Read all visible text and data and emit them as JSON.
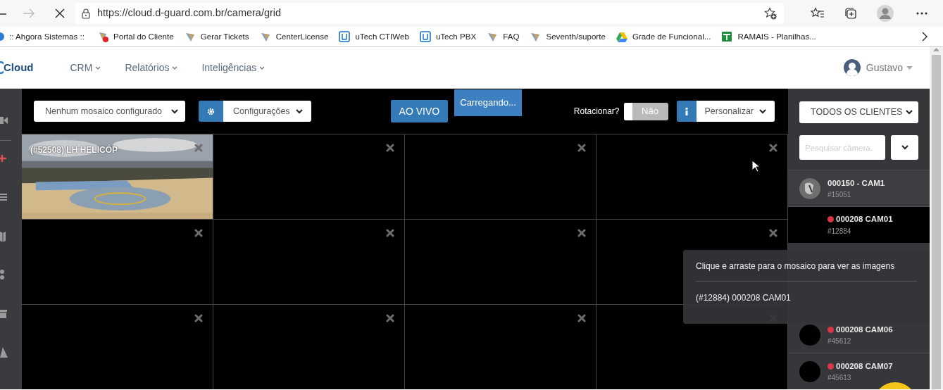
{
  "browser": {
    "url": "https://cloud.d-guard.com.br/camera/grid",
    "bookmarks": [
      {
        "label": ":: Ahgora Sistemas ::"
      },
      {
        "label": "Portal do Cliente"
      },
      {
        "label": "Gerar Tickets"
      },
      {
        "label": "CenterLicense"
      },
      {
        "label": "uTech CTIWeb"
      },
      {
        "label": "uTech PBX"
      },
      {
        "label": "FAQ"
      },
      {
        "label": "Seventh/suporte"
      },
      {
        "label": "Grade de Funcional..."
      },
      {
        "label": "RAMAIS - Planilhas..."
      }
    ]
  },
  "navbar": {
    "logo": "Cloud",
    "menus": [
      "CRM",
      "Relatórios",
      "Inteligências"
    ],
    "user": "Gustavo"
  },
  "toolbar": {
    "mosaic_select": "Nenhum mosaico configurado",
    "settings": "Configurações",
    "live": "AO VIVO",
    "loading": "Carregando...",
    "rotate_label": "Rotacionar?",
    "rotate_toggle": {
      "label": "Não",
      "on": false
    },
    "customize": "Personalizar"
  },
  "grid": {
    "cells": [
      {
        "kind": "picture",
        "title": "(#52508) LH HELICÓP"
      },
      {
        "kind": "empty"
      },
      {
        "kind": "empty"
      },
      {
        "kind": "empty"
      },
      {
        "kind": "empty"
      },
      {
        "kind": "empty"
      },
      {
        "kind": "empty"
      },
      {
        "kind": "empty"
      },
      {
        "kind": "empty"
      },
      {
        "kind": "empty"
      },
      {
        "kind": "empty"
      },
      {
        "kind": "empty"
      }
    ]
  },
  "camera_panel": {
    "client_select": "TODOS OS CLIENTES",
    "search": {
      "placeholder": "Pesquisar câmera."
    },
    "cameras": [
      {
        "kind": "picture",
        "name": "000150 - CAM1",
        "code": "#15051",
        "selected": false
      },
      {
        "kind": "plain",
        "name": "000208 CAM01",
        "code": "#12884",
        "color": "#dc3545",
        "selected": true
      },
      {
        "kind": "blank",
        "name": "000208 CAM06",
        "code": "#45612",
        "color": "#dc3545",
        "selected": false
      },
      {
        "kind": "blank",
        "name": "000208 CAM07",
        "code": "#45613",
        "color": "#dc3545",
        "selected": false
      }
    ]
  },
  "drag_tooltip": {
    "hint": "Clique e arraste para o mosaico para ver as imagens",
    "camera": "(#12884) 000208 CAM01"
  }
}
